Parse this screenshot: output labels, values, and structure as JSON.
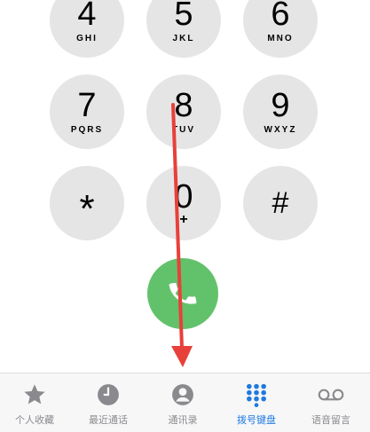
{
  "keys": [
    {
      "digit": "4",
      "letters": "GHI"
    },
    {
      "digit": "5",
      "letters": "JKL"
    },
    {
      "digit": "6",
      "letters": "MNO"
    },
    {
      "digit": "7",
      "letters": "PQRS"
    },
    {
      "digit": "8",
      "letters": "TUV"
    },
    {
      "digit": "9",
      "letters": "WXYZ"
    },
    {
      "digit": "*",
      "letters": ""
    },
    {
      "digit": "0",
      "letters": "+"
    },
    {
      "digit": "#",
      "letters": ""
    }
  ],
  "tabs": [
    {
      "label": "个人收藏",
      "icon": "star-icon"
    },
    {
      "label": "最近通话",
      "icon": "clock-icon"
    },
    {
      "label": "通讯录",
      "icon": "contact-icon"
    },
    {
      "label": "拨号键盘",
      "icon": "keypad-icon",
      "active": true
    },
    {
      "label": "语音留言",
      "icon": "voicemail-icon"
    }
  ],
  "colors": {
    "key_bg": "#e5e5e6",
    "call_green": "#62c26b",
    "active_blue": "#1f7ae0",
    "inactive_gray": "#8a8a8e",
    "arrow_red": "#e8403a"
  }
}
